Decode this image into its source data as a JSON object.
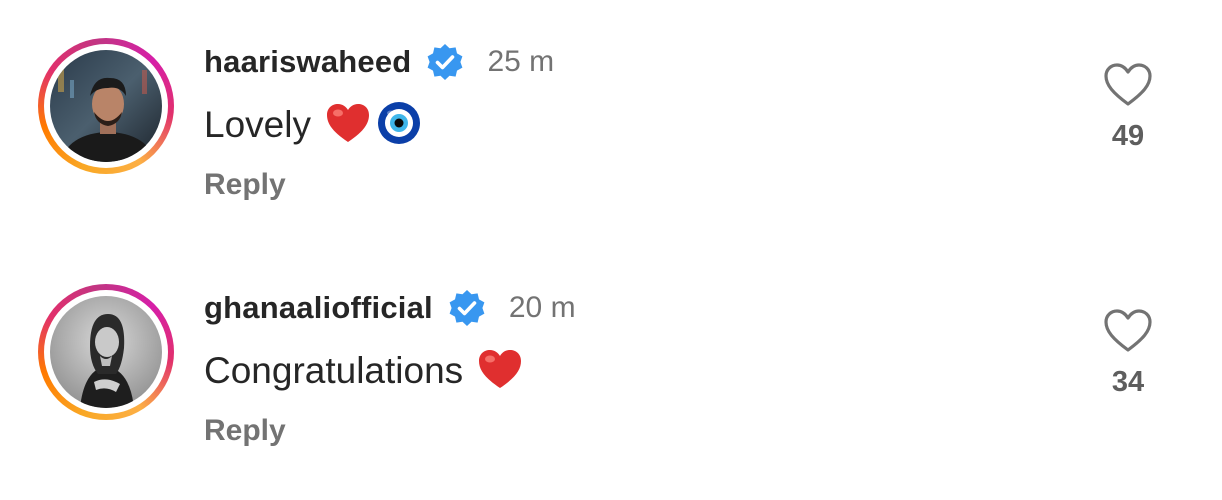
{
  "comments": [
    {
      "username": "haariswaheed",
      "verified_icon": "verified-badge-icon",
      "time": "25 m",
      "text": "Lovely",
      "emojis": [
        "red-heart",
        "nazar-amulet"
      ],
      "reply_label": "Reply",
      "like_icon": "heart-outline-icon",
      "likes": "49"
    },
    {
      "username": "ghanaaliofficial",
      "verified_icon": "verified-badge-icon",
      "time": "20 m",
      "text": "Congratulations",
      "emojis": [
        "red-heart"
      ],
      "reply_label": "Reply",
      "like_icon": "heart-outline-icon",
      "likes": "34"
    }
  ],
  "colors": {
    "verified_blue": "#3897f0",
    "text_primary": "#262626",
    "text_secondary": "#737373",
    "emoji_red": "#e02f2f"
  }
}
